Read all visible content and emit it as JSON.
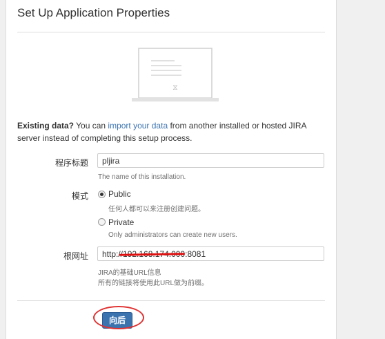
{
  "page": {
    "title": "Set Up Application Properties"
  },
  "intro": {
    "bold": "Existing data?",
    "pre": " You can ",
    "link": "import your data",
    "post": " from another installed or hosted JIRA server instead of completing this setup process."
  },
  "form": {
    "app_title": {
      "label": "程序标题",
      "value": "pljira",
      "help": "The name of this installation."
    },
    "mode": {
      "label": "模式",
      "options": [
        {
          "label": "Public",
          "help": "任何人都可以来注册创建问题。",
          "checked": true
        },
        {
          "label": "Private",
          "help": "Only administrators can create new users.",
          "checked": false
        }
      ]
    },
    "base_url": {
      "label": "根网址",
      "value": "http://192.168.174.000:8081",
      "help_line1": "JIRA的基础URL信息",
      "help_line2": "所有的链接将使用此URL做为前缀。"
    }
  },
  "buttons": {
    "next_label": "向后"
  },
  "colors": {
    "link": "#3b73af",
    "button": "#3b73af",
    "annotation": "#e03030"
  }
}
